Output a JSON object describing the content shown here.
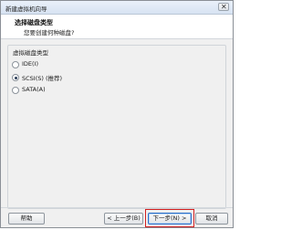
{
  "window": {
    "title": "新建虚拟机向导",
    "close_glyph": "✕"
  },
  "header": {
    "title": "选择磁盘类型",
    "subtitle": "您要创建何种磁盘?"
  },
  "group": {
    "legend": "虚拟磁盘类型",
    "options": [
      {
        "label": "IDE(I)",
        "checked": false
      },
      {
        "label": "SCSI(S)  (推荐)",
        "checked": true
      },
      {
        "label": "SATA(A)",
        "checked": false
      }
    ]
  },
  "buttons": {
    "help": "帮助",
    "back": "< 上一步(B)",
    "next": "下一步(N) >",
    "cancel": "取消"
  },
  "colors": {
    "highlight": "#d32020",
    "accent": "#2b6fc7"
  }
}
